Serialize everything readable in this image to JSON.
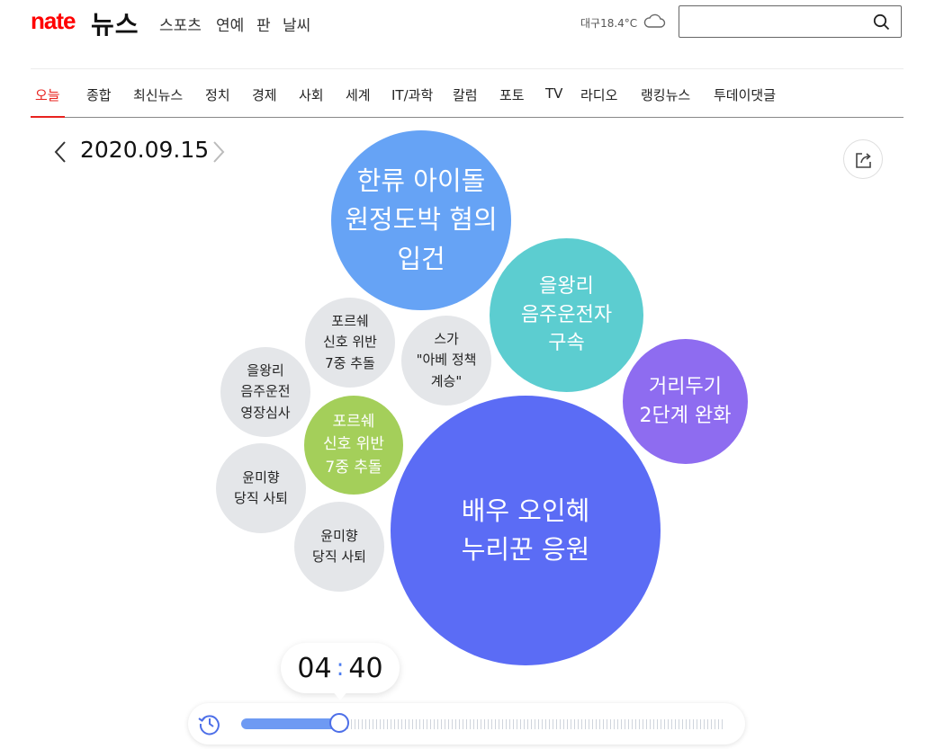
{
  "header": {
    "logo_nate": "nate",
    "logo_news": "뉴스",
    "links": [
      "스포츠",
      "연예",
      "판",
      "날씨"
    ],
    "weather": "대구18.4°C",
    "weather_icon": "cloud-icon",
    "search_placeholder": ""
  },
  "nav": {
    "items": [
      "오늘",
      "종합",
      "최신뉴스",
      "정치",
      "경제",
      "사회",
      "세계",
      "IT/과학",
      "칼럼",
      "포토",
      "TV",
      "라디오",
      "랭킹뉴스",
      "투데이댓글"
    ],
    "active": "오늘",
    "accent": "#e8231f"
  },
  "date_bar": {
    "date": "2020.09.15",
    "prev_icon": "chevron-left-icon",
    "next_icon": "chevron-right-icon",
    "share_icon": "share-icon"
  },
  "bubbles": [
    {
      "text": "한류 아이돌\n원정도박 혐의\n입건",
      "color": "#66a3f5"
    },
    {
      "text": "을왕리\n음주운전자\n구속",
      "color": "#5ccdd0"
    },
    {
      "text": "거리두기\n2단계 완화",
      "color": "#8e6cf0"
    },
    {
      "text": "배우 오인혜\n누리꾼 응원",
      "color": "#5b6cf5"
    },
    {
      "text": "포르쉐\n신호 위반\n7중 추돌",
      "color": "#a4cf5a"
    },
    {
      "text": "포르쉐\n신호 위반\n7중 추돌",
      "color": "#e4e6e9"
    },
    {
      "text": "스가\n\"아베 정책\n계승\"",
      "color": "#e4e6e9"
    },
    {
      "text": "을왕리\n음주운전\n영장심사",
      "color": "#e4e6e9"
    },
    {
      "text": "윤미향\n당직 사퇴",
      "color": "#e4e6e9"
    },
    {
      "text": "윤미향\n당직 사퇴",
      "color": "#e4e6e9"
    }
  ],
  "timeline": {
    "hour": "04",
    "minute": "40",
    "progress": 0.2,
    "clock_icon": "history-clock-icon"
  }
}
